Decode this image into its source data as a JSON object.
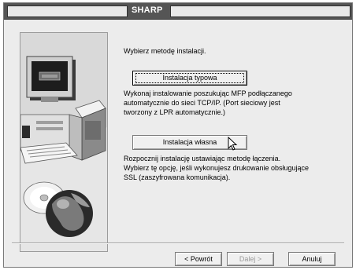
{
  "window": {
    "title": "SHARP"
  },
  "main": {
    "prompt": "Wybierz metodę instalacji.",
    "typical": {
      "label": "Instalacja typowa",
      "desc1": "Wykonaj instalowanie poszukując MFP podłączanego",
      "desc2": "automatycznie do sieci  TCP/IP.  (Port sieciowy jest",
      "desc3": "tworzony z  LPR automatycznie.)"
    },
    "custom": {
      "label": "Instalacja własna",
      "desc1": "Rozpocznij  instalację ustawiając metodę łączenia.",
      "desc2": "Wybierz tę opcję, jeśli wykonujesz drukowanie obsługujące",
      "desc3": "SSL (zaszyfrowana komunikacja)."
    }
  },
  "footer": {
    "back_label": "< Powrót",
    "next_label": "Dalej >",
    "cancel_label": "Anuluj"
  },
  "icons": [
    "computer-icon",
    "globe-icon",
    "cd-disc-icon",
    "mouse-cursor-icon"
  ]
}
